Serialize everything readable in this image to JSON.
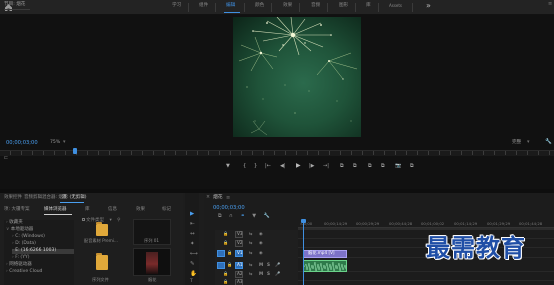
{
  "topbar": {
    "tabs": [
      "学习",
      "组件",
      "编辑",
      "颜色",
      "效果",
      "音频",
      "图形",
      "库",
      "Assets"
    ],
    "active_tab": "编辑",
    "more": "»"
  },
  "monitor": {
    "title": "节目: 烟花",
    "timecode": "00;00;03;00",
    "zoom": "75%",
    "fit": "完整",
    "controls": [
      "▼",
      "{",
      "}",
      "|←",
      "◀|",
      "▶",
      "|▶",
      "→|",
      "⧉",
      "⧉",
      "⧉",
      "⧉",
      "📷",
      "⧉"
    ]
  },
  "project": {
    "panel_tabs": [
      "效果控件",
      "音频剪辑混合器: 烟花",
      "源: (无剪辑)"
    ],
    "browser_tabs": [
      "项: 大疆专案",
      "媒体浏览器",
      "库",
      "信息",
      "效果",
      "标记"
    ],
    "active_browser_tab": "媒体浏览器",
    "toolbar": "文件类型",
    "tree": [
      {
        "label": "收藏夹",
        "caret": "›"
      },
      {
        "label": "本地驱动器",
        "caret": "∨"
      },
      {
        "label": "C: (Windows)",
        "caret": "›"
      },
      {
        "label": "D: (Data)",
        "caret": "›"
      },
      {
        "label": "E: (16:6266 1003)",
        "caret": "›"
      },
      {
        "label": "F: (YY)",
        "caret": "›"
      },
      {
        "label": "网络驱动器",
        "caret": "›"
      },
      {
        "label": "Creative Cloud",
        "caret": "›"
      }
    ],
    "items": [
      {
        "label": "配音素材 Premi..."
      },
      {
        "label": "序列 01"
      },
      {
        "label": "序列文件"
      },
      {
        "label": "烟花"
      }
    ]
  },
  "tools": [
    "▶",
    "⇤",
    "↔",
    "✦",
    "⟷",
    "✎",
    "✋",
    "T"
  ],
  "timeline": {
    "title": "烟花",
    "close": "×",
    "timecode": "00;00;03;00",
    "ruler": [
      ":00;00",
      "00;00;14;29",
      "00;00;29;29",
      "00;00;44;28",
      "00;01;00;02",
      "00;01;14;29",
      "00;01;29;29",
      "00;01;44;28"
    ],
    "tracks": [
      {
        "label": "V3",
        "target": false
      },
      {
        "label": "V2",
        "target": false
      },
      {
        "label": "V1",
        "target": true
      },
      {
        "label": "A1",
        "target": true
      },
      {
        "label": "A2",
        "target": false
      },
      {
        "label": "A3",
        "target": false
      }
    ],
    "video_clip": "烟花.mp4 [V]",
    "colors": {
      "accent": "#3f8fe0",
      "video_clip": "#7d72c9",
      "audio_clip": "#2e7a4a"
    }
  },
  "watermark": "最需教育"
}
